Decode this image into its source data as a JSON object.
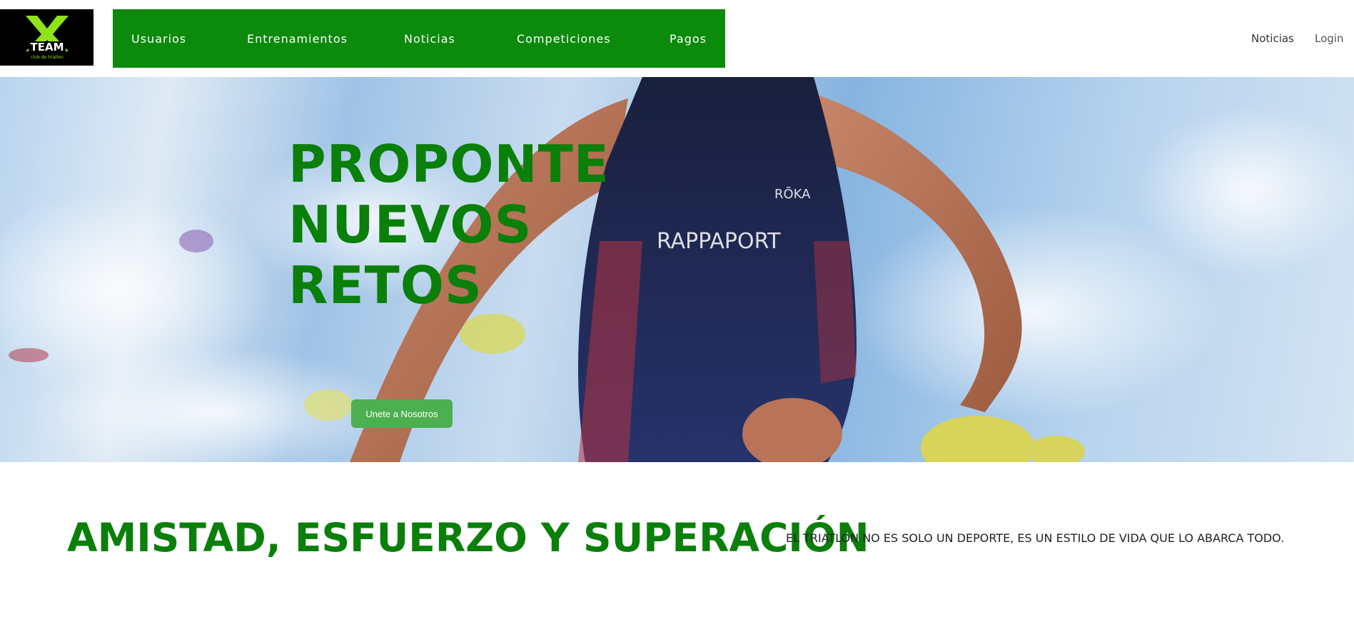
{
  "logo": {
    "mark": "X",
    "text": "TEAM",
    "subtext": "club de triatlon"
  },
  "main_nav": {
    "items": [
      "Usuarios",
      "Entrenamientos",
      "Noticias",
      "Competiciones",
      "Pagos"
    ]
  },
  "right_nav": {
    "news_label": "Noticias",
    "login_label": "Login"
  },
  "hero": {
    "title_lines": [
      "PROPONTE",
      "NUEVOS",
      "RETOS"
    ],
    "cta_label": "Unete a Nosotros",
    "image_semantic": "triathlete-swimmer-photo"
  },
  "section": {
    "slogan": "AMISTAD, ESFUERZO Y SUPERACIÓN",
    "tagline": "EL TRIATLÓN NO ES SOLO UN DEPORTE, ES UN ESTILO DE VIDA QUE LO ABARCA TODO."
  },
  "colors": {
    "brand_green": "#0b8a0b",
    "cta_green": "#4caf50",
    "logo_bg": "#000000",
    "logo_accent": "#8fe31a"
  }
}
